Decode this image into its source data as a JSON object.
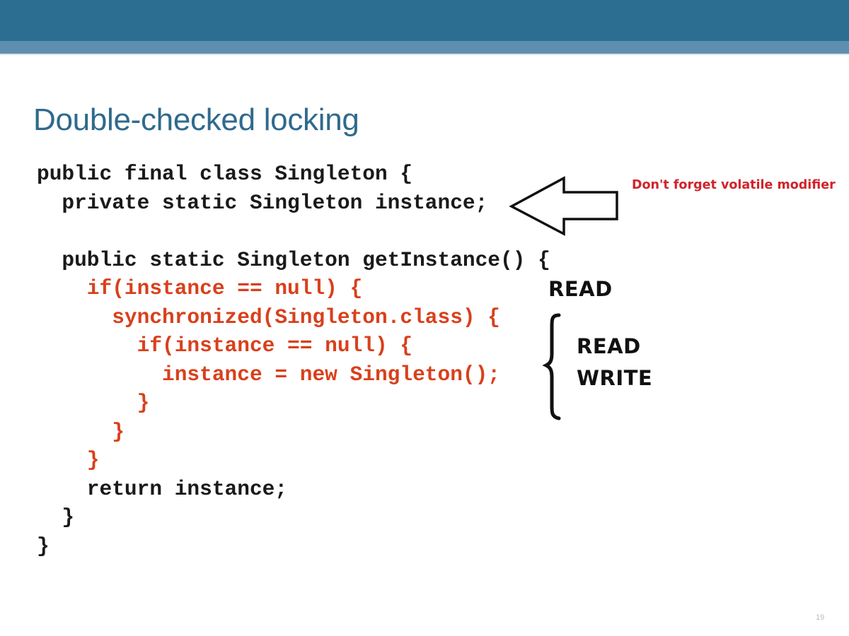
{
  "slide": {
    "title": "Double-checked locking",
    "page_number": "19",
    "colors": {
      "header": "#2c6e92",
      "title": "#2f6a8c",
      "code_default": "#1a1a1a",
      "code_highlight": "#d8401c",
      "annotation": "#d0242c"
    }
  },
  "code": {
    "lines": [
      {
        "text": "public final class Singleton {",
        "highlight": false
      },
      {
        "text": "  private static Singleton instance;",
        "highlight": false
      },
      {
        "text": "",
        "highlight": false
      },
      {
        "text": "  public static Singleton getInstance() {",
        "highlight": false
      },
      {
        "text": "    if(instance == null) {",
        "highlight": true
      },
      {
        "text": "      synchronized(Singleton.class) {",
        "highlight": true
      },
      {
        "text": "        if(instance == null) {",
        "highlight": true
      },
      {
        "text": "          instance = new Singleton();",
        "highlight": true
      },
      {
        "text": "        }",
        "highlight": true
      },
      {
        "text": "      }",
        "highlight": true
      },
      {
        "text": "    }",
        "highlight": true
      },
      {
        "text": "    return instance;",
        "highlight": false
      },
      {
        "text": "  }",
        "highlight": false
      },
      {
        "text": "}",
        "highlight": false
      }
    ]
  },
  "annotations": {
    "volatile_note": "Don't forget volatile modifier",
    "arrow_icon": "left-arrow-outline",
    "first_check": "READ",
    "locked_read": "READ",
    "locked_write": "WRITE",
    "brace_icon": "curly-brace-left"
  }
}
